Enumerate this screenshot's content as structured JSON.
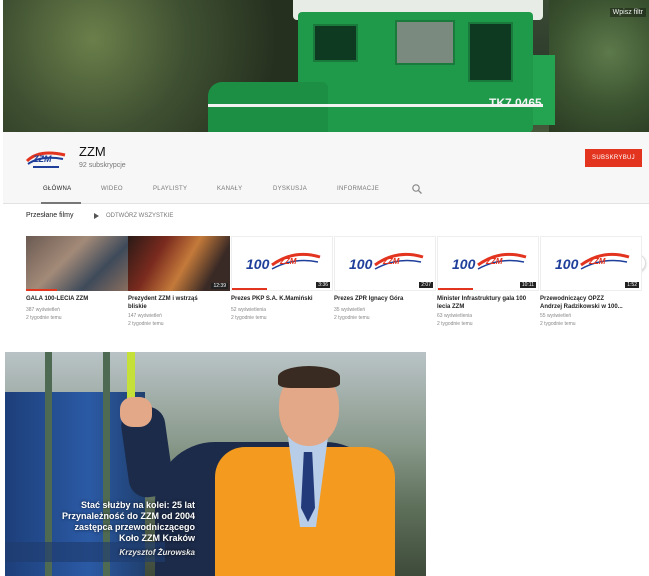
{
  "banner": {
    "watermark": "Wpisz filtr",
    "loco_number": "TK7 0465"
  },
  "channel": {
    "name": "ZZM",
    "subscribers": "92 subskrypcje",
    "subscribe_label": "SUBSKRYBUJ",
    "colors": {
      "accent": "#e3341f",
      "logo_blue": "#1f3f9a",
      "logo_red": "#e3341f"
    }
  },
  "tabs": [
    {
      "label": "GŁÓWNA",
      "active": true
    },
    {
      "label": "WIDEO",
      "active": false
    },
    {
      "label": "PLAYLISTY",
      "active": false
    },
    {
      "label": "KANAŁY",
      "active": false
    },
    {
      "label": "DYSKUSJA",
      "active": false
    },
    {
      "label": "INFORMACJE",
      "active": false
    }
  ],
  "search_icon": "search-icon",
  "section": {
    "title": "Przesłane filmy",
    "play_all": "ODTWÓRZ WSZYSTKIE"
  },
  "videos": [
    {
      "title": "GALA 100-LECIA ZZM",
      "title2": "",
      "views": "387 wyświetleń",
      "age": "2 tygodnie temu",
      "duration": "",
      "thumb": "photo1",
      "progress": 0.3
    },
    {
      "title": "Prezydent ZZM i wstrząś",
      "title2": "bliskie",
      "views": "147 wyświetleń",
      "age": "2 tygodnie temu",
      "duration": "12:39",
      "thumb": "photo2",
      "progress": 0
    },
    {
      "title": "Prezes PKP S.A. K.Mamiński",
      "title2": "",
      "views": "52 wyświetlenia",
      "age": "2 tygodnie temu",
      "duration": "3:36",
      "thumb": "logo",
      "progress": 0.35
    },
    {
      "title": "Prezes ZPR Ignacy Góra",
      "title2": "",
      "views": "35 wyświetleń",
      "age": "2 tygodnie temu",
      "duration": "2:07",
      "thumb": "logo",
      "progress": 0
    },
    {
      "title": "Minister Infrastruktury gala 100",
      "title2": "lecia ZZM",
      "views": "63 wyświetlenia",
      "age": "2 tygodnie temu",
      "duration": "10:11",
      "thumb": "logo",
      "progress": 0.35
    },
    {
      "title": "Przewodniczący OPZZ",
      "title2": "Andrzej Radzikowski w 100...",
      "views": "55 wyświetleń",
      "age": "2 tygodnie temu",
      "duration": "1:52",
      "thumb": "logo",
      "progress": 0
    }
  ],
  "photo": {
    "caption_lines": [
      "Stać służby na kolei: 25 lat",
      "Przynależność do ZZM od 2004",
      "zastępca przewodniczącego",
      "Koło ZZM Kraków"
    ],
    "caption_name": "Krzysztof Żurowska"
  }
}
